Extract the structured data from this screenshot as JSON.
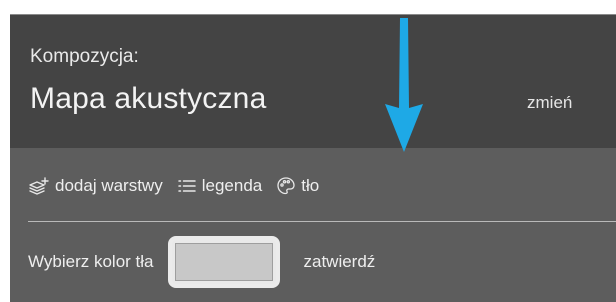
{
  "composition": {
    "label": "Kompozycja:",
    "title": "Mapa akustyczna",
    "change_label": "zmień"
  },
  "toolbar": {
    "add_layers_label": "dodaj warstwy",
    "legend_label": "legenda",
    "background_label": "tło"
  },
  "background": {
    "choose_color_label": "Wybierz kolor tła",
    "current_color": "#c8c8c8",
    "confirm_label": "zatwierdź"
  },
  "colors": {
    "header_bg": "#444444",
    "panel_bg": "#5d5d5d",
    "annotation_arrow": "#1ea9e6"
  },
  "icons": {
    "layers": "layers-plus-icon",
    "legend": "list-icon",
    "background": "palette-icon"
  }
}
